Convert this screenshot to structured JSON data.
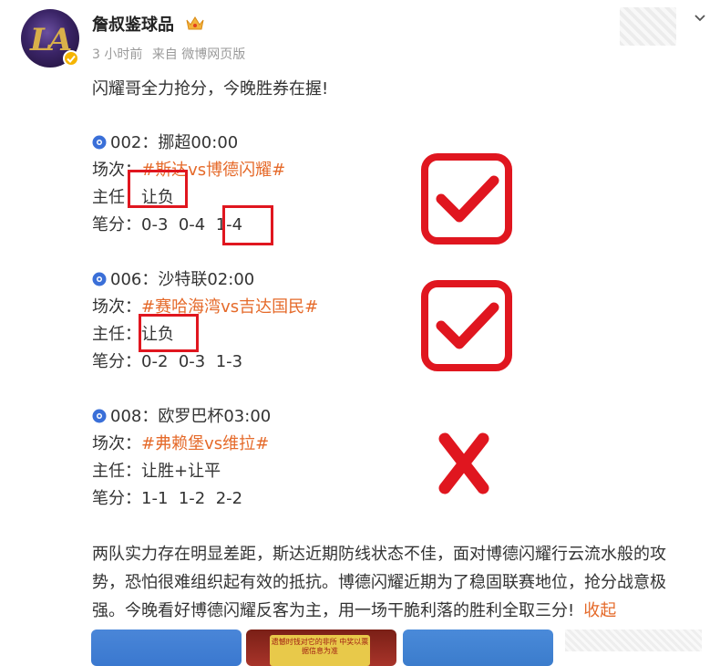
{
  "post": {
    "author": "詹叔鉴球品",
    "time": "3 小时前",
    "source": "来自 微博网页版",
    "intro": "闪耀哥全力抢分，今晚胜券在握!",
    "colors": {
      "accent": "#e56a2a",
      "mark_red": "#e0161f"
    }
  },
  "matches": [
    {
      "header": "002：挪超00:00",
      "venue_label": "场次：",
      "venue_tag": "#斯达vs博德闪耀#",
      "main_label": "主任：",
      "main_value": "让负",
      "score_label": "笔分：",
      "scores": [
        "0-3",
        "0-4",
        "1-4"
      ],
      "result_icon": "check-mark-icon"
    },
    {
      "header": "006：沙特联02:00",
      "venue_label": "场次：",
      "venue_tag": "#赛哈海湾vs吉达国民#",
      "main_label": "主任：",
      "main_value": "让负",
      "score_label": "笔分：",
      "scores": [
        "0-2",
        "0-3",
        "1-3"
      ],
      "result_icon": "check-mark-icon"
    },
    {
      "header": "008：欧罗巴杯03:00",
      "venue_label": "场次：",
      "venue_tag": "#弗赖堡vs维拉#",
      "main_label": "主任：",
      "main_value": "让胜+让平",
      "score_label": "笔分：",
      "scores": [
        "1-1",
        "1-2",
        "2-2"
      ],
      "result_icon": "cross-mark-icon"
    }
  ],
  "analysis": {
    "lines": [
      "两队实力存在明显差距，斯达近期防线状态不佳，面对博德闪耀行云流水般的攻",
      "势，恐怕很难组织起有效的抵抗。博德闪耀近期为了稳固联赛地位，抢分战意极",
      "强。今晚看好博德闪耀反客为主，用一场干脆利落的胜利全取三分!"
    ],
    "collapse_label": "收起"
  },
  "thumbnails": {
    "note_text": "遗憾时钱对它的非所 中奖以票据信息为准"
  }
}
